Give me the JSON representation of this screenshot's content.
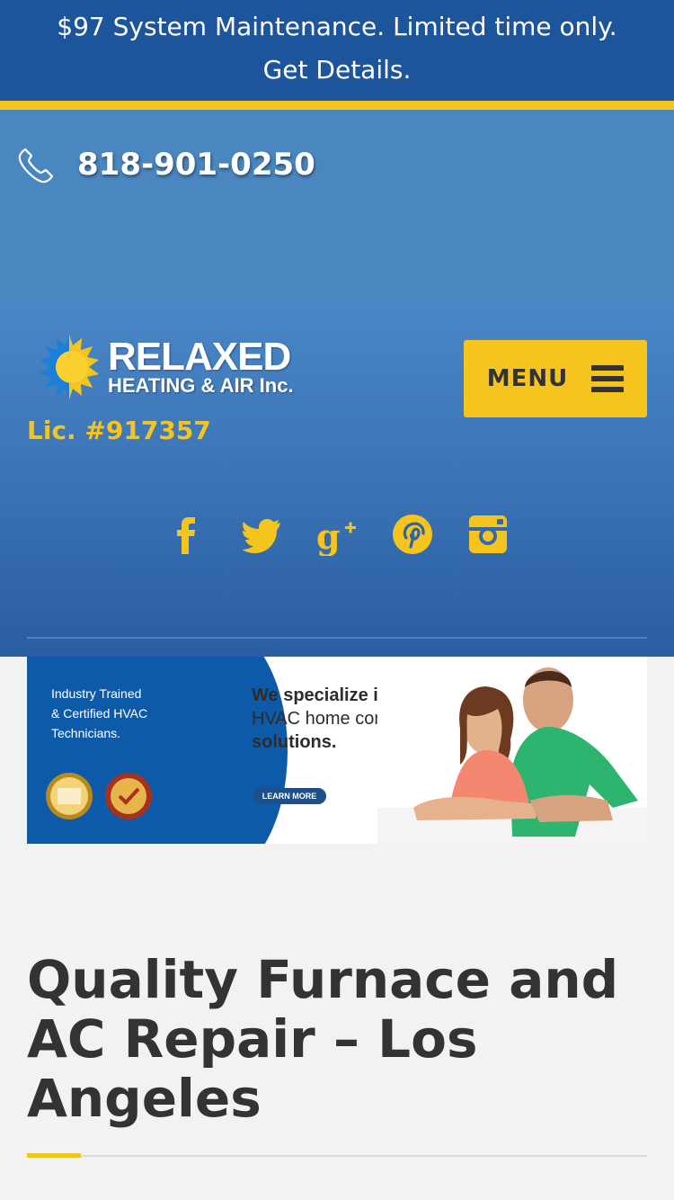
{
  "promo": {
    "line1": "$97 System Maintenance. Limited time only.",
    "line2": "Get Details."
  },
  "contact": {
    "phone": "818-901-0250",
    "icon": "phone-icon"
  },
  "brand": {
    "name_line1": "RELAXED",
    "name_line2": "HEATING & AIR Inc.",
    "license": "Lic. #917357"
  },
  "nav": {
    "menu_label": "MENU",
    "menu_icon": "hamburger-icon"
  },
  "social": [
    {
      "name": "facebook",
      "icon": "facebook-icon"
    },
    {
      "name": "twitter",
      "icon": "twitter-icon"
    },
    {
      "name": "google-plus",
      "icon": "google-plus-icon"
    },
    {
      "name": "pinterest",
      "icon": "pinterest-icon"
    },
    {
      "name": "instagram",
      "icon": "instagram-icon"
    }
  ],
  "banner": {
    "left_line1": "Industry Trained",
    "left_line2": "& Certified HVAC",
    "left_line3": "Technicians.",
    "heading_line1": "We specialize in",
    "heading_line2": "HVAC home comfort",
    "heading_line3": "solutions.",
    "cta": "LEARN MORE"
  },
  "page": {
    "title_line1": "Quality Furnace and",
    "title_line2": "AC Repair – Los",
    "title_line3": "Angeles"
  },
  "colors": {
    "promo_bg": "#1d559c",
    "accent_yellow": "#f6c51d",
    "header_blue": "#3a74b6",
    "text_dark": "#333333"
  }
}
